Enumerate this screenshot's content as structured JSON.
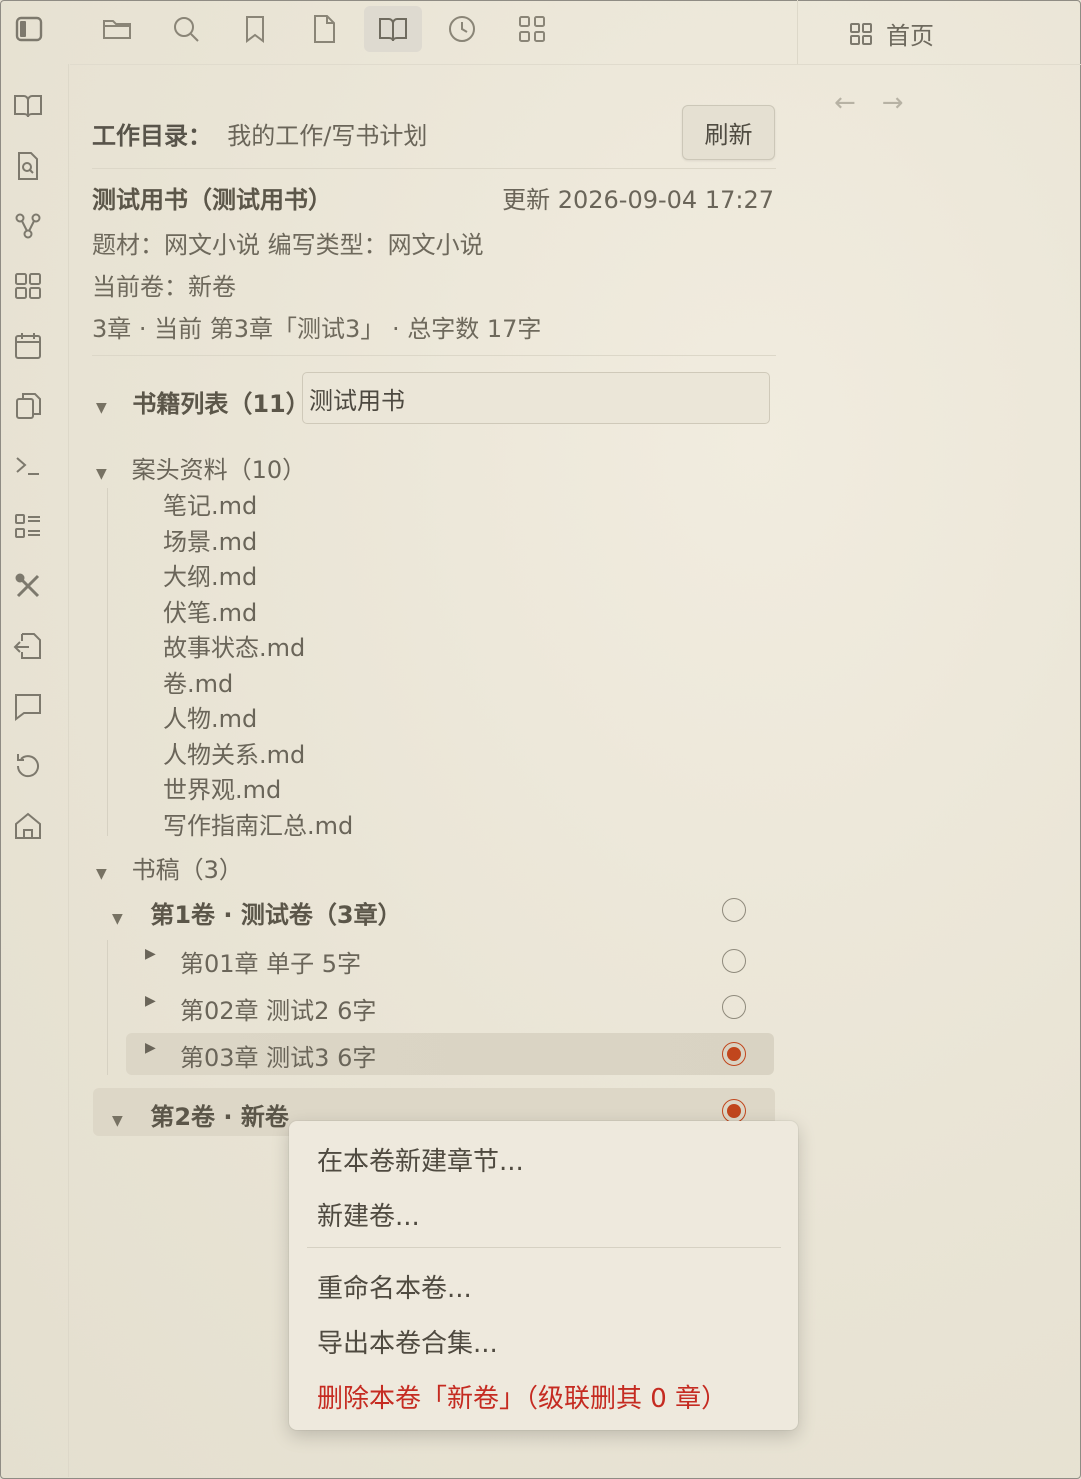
{
  "tab": {
    "title": "首页"
  },
  "workdir": {
    "label": "工作目录：",
    "path": "我的工作/写书计划",
    "refresh": "刷新"
  },
  "book": {
    "title": "测试用书（测试用书）",
    "updated": "更新 2026-09-04 17:27",
    "genre_line": "题材：网文小说 编写类型：网文小说",
    "current_volume": "当前卷：新卷",
    "progress": "3章 · 当前 第3章「测试3」 · 总字数 17字"
  },
  "booklist": {
    "label": "书籍列表（11）",
    "selected": "测试用书"
  },
  "reference": {
    "label": "案头资料（10）",
    "files": [
      "笔记.md",
      "场景.md",
      "大纲.md",
      "伏笔.md",
      "故事状态.md",
      "卷.md",
      "人物.md",
      "人物关系.md",
      "世界观.md",
      "写作指南汇总.md"
    ]
  },
  "manuscript": {
    "label": "书稿（3）",
    "volume1": {
      "label": "第1卷 · 测试卷（3章）",
      "chapters": [
        {
          "label": "第01章 单子   5字",
          "selected": false
        },
        {
          "label": "第02章 测试2   6字",
          "selected": false
        },
        {
          "label": "第03章 测试3   6字",
          "selected": true
        }
      ]
    },
    "volume2": {
      "label": "第2卷 · 新卷",
      "selected": true
    }
  },
  "context_menu": {
    "new_chapter": "在本卷新建章节...",
    "new_volume": "新建卷...",
    "rename_volume": "重命名本卷...",
    "export_volume": "导出本卷合集...",
    "delete_volume": "删除本卷「新卷」（级联删其 0 章）"
  },
  "colors": {
    "accent": "#c1461d",
    "danger": "#c52b21",
    "background": "#ebe6d8"
  },
  "icons": {
    "toolbar": [
      "sidebar-toggle-icon",
      "folder-icon",
      "search-icon",
      "bookmark-icon",
      "file-icon",
      "open-book-icon",
      "clock-icon",
      "grid-icon"
    ],
    "rail": [
      "book-icon",
      "file-search-icon",
      "graph-icon",
      "dashboard-icon",
      "calendar-icon",
      "copy-icon",
      "terminal-icon",
      "list-icon",
      "tools-icon",
      "import-icon",
      "comment-icon",
      "history-icon",
      "home-icon"
    ]
  }
}
